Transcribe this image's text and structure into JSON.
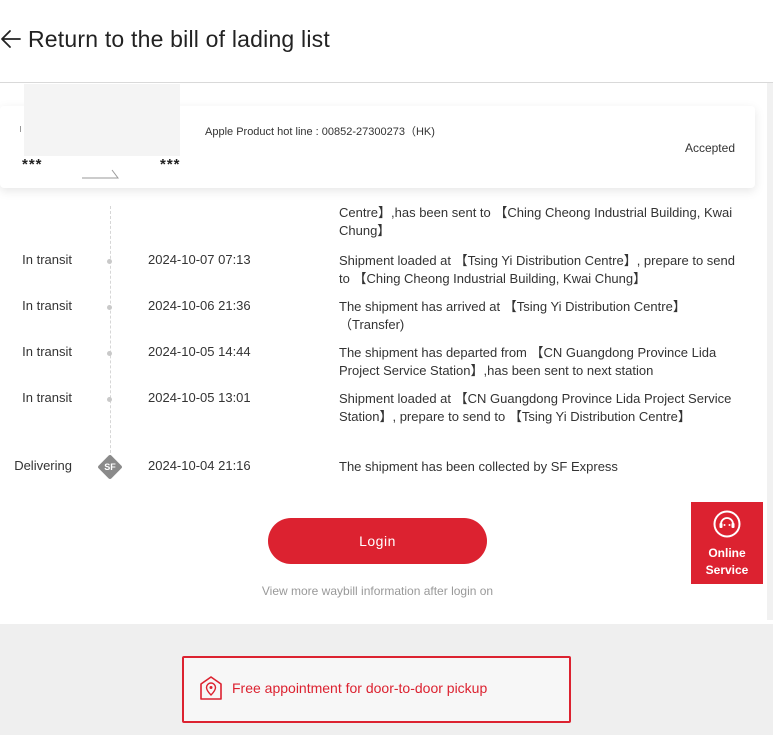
{
  "header": {
    "back_label": "Return to the bill of lading list"
  },
  "card": {
    "origin_mask": "***",
    "destination_mask": "***",
    "hotline": "Apple Product hot line : 00852-27300273（HK)",
    "status": "Accepted"
  },
  "timeline": {
    "partial_desc": "Centre】,has been sent to 【Ching Cheong Industrial Building, Kwai Chung】",
    "rows": [
      {
        "status": "In transit",
        "time": "2024-10-07 07:13",
        "desc": "Shipment loaded at 【Tsing Yi Distribution Centre】, prepare to send to 【Ching Cheong Industrial Building, Kwai Chung】"
      },
      {
        "status": "In transit",
        "time": "2024-10-06 21:36",
        "desc": "The shipment has arrived at 【Tsing Yi Distribution Centre】（Transfer)"
      },
      {
        "status": "In transit",
        "time": "2024-10-05 14:44",
        "desc": "The shipment has departed from 【CN Guangdong Province Lida Project Service Station】,has been sent to next station"
      },
      {
        "status": "In transit",
        "time": "2024-10-05 13:01",
        "desc": "Shipment loaded at 【CN Guangdong Province Lida Project Service Station】, prepare to send to 【Tsing Yi Distribution Centre】"
      },
      {
        "status": "Delivering",
        "time": "2024-10-04 21:16",
        "desc": "The shipment has been collected by SF Express",
        "badge": "SF"
      }
    ]
  },
  "login": {
    "button_label": "Login",
    "hint": "View more waybill information after login on"
  },
  "online_service": {
    "line1": "Online",
    "line2": "Service"
  },
  "footer": {
    "pickup_label": "Free appointment for door-to-door pickup"
  },
  "colors": {
    "brand_red": "#dc2230",
    "timeline_dot": "#c9c9c9",
    "badge_gray": "#8a8a8a"
  },
  "icons": {
    "back": "arrow-left-icon",
    "online_service": "customer-service-icon",
    "pickup": "location-pin-icon",
    "delivering": "sf-express-badge-icon"
  }
}
